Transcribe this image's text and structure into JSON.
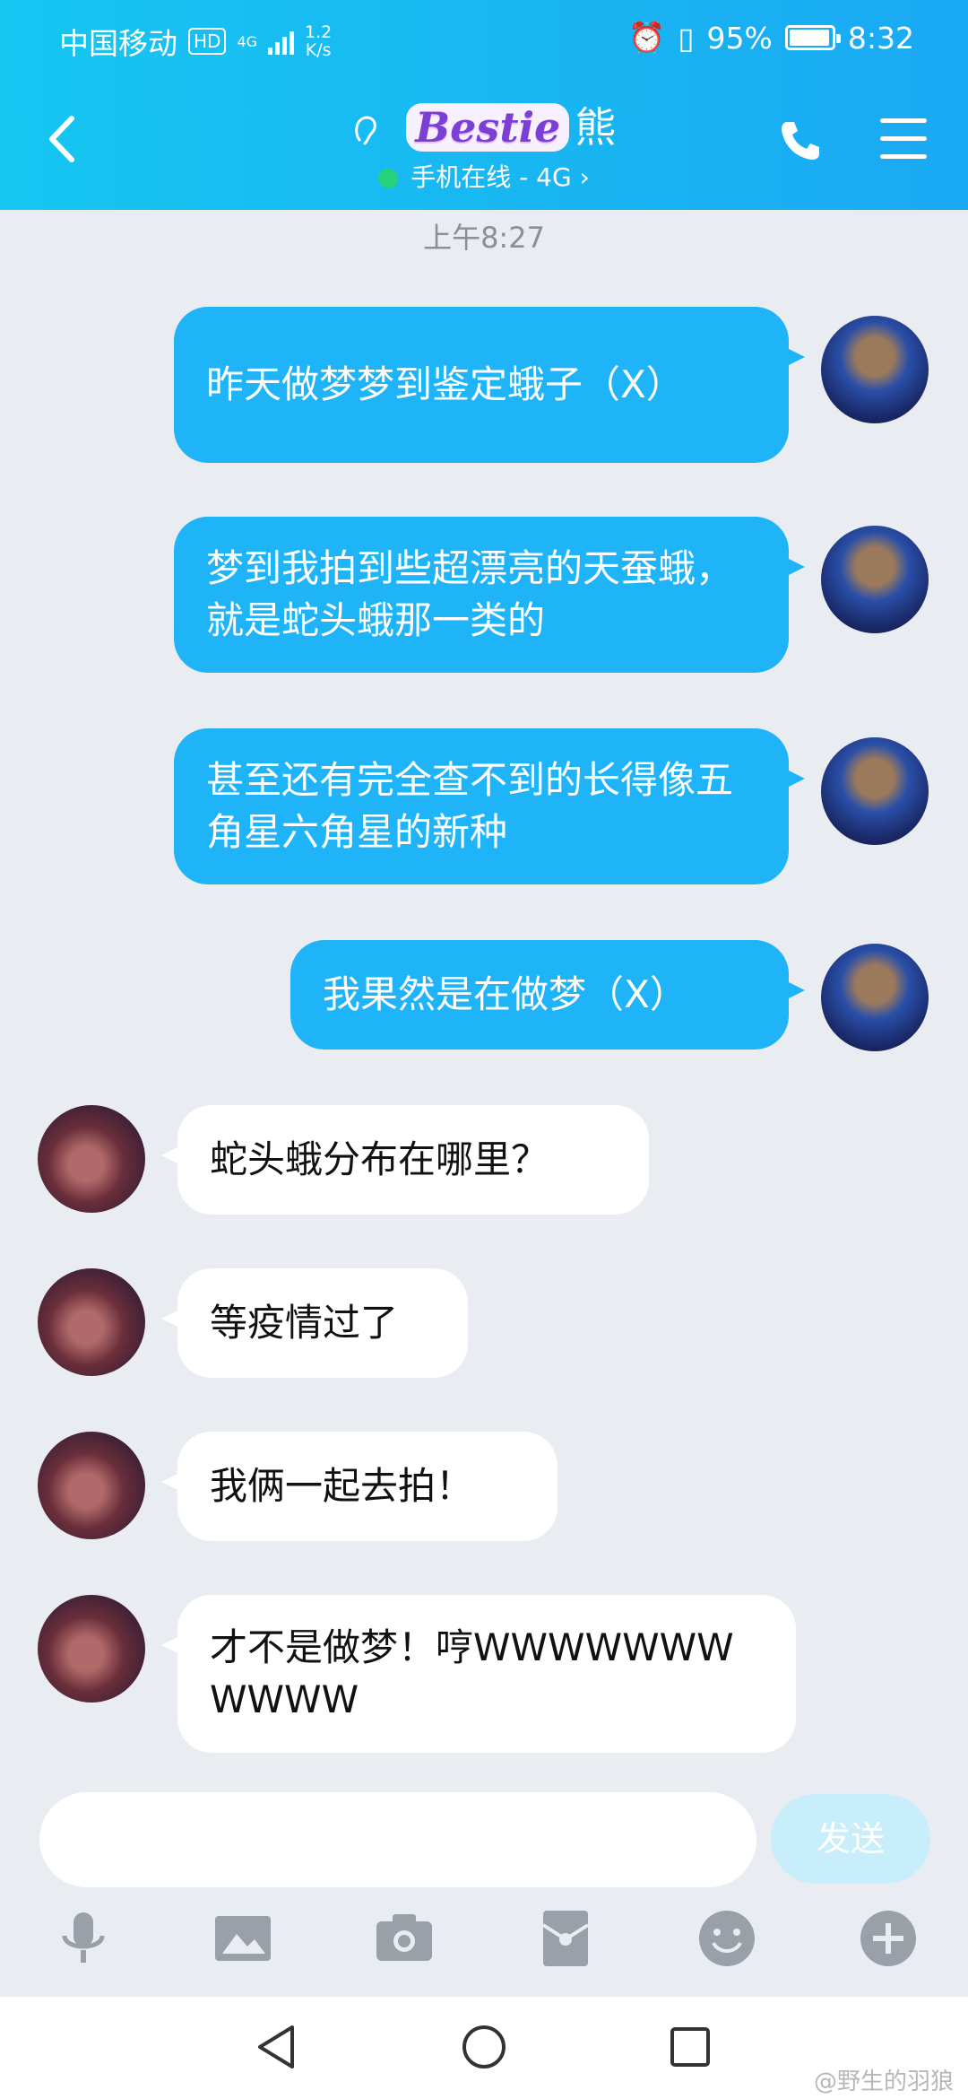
{
  "status": {
    "carrier": "中国移动",
    "hd": "HD",
    "network": "4G",
    "speed_top": "1.2",
    "speed_bottom": "K/s",
    "battery": "95%",
    "time": "8:32"
  },
  "header": {
    "logo_text": "Bestie",
    "name": "熊",
    "online": "手机在线 - 4G",
    "chevron": "›"
  },
  "timestamp": "上午8:27",
  "messages": [
    {
      "side": "mine",
      "text": "昨天做梦梦到鉴定蛾子（X）"
    },
    {
      "side": "mine",
      "text": "梦到我拍到些超漂亮的天蚕蛾，就是蛇头蛾那一类的"
    },
    {
      "side": "mine",
      "text": "甚至还有完全查不到的长得像五角星六角星的新种"
    },
    {
      "side": "mine",
      "text": "我果然是在做梦（X）"
    },
    {
      "side": "theirs",
      "text": "蛇头蛾分布在哪里？"
    },
    {
      "side": "theirs",
      "text": "等疫情过了"
    },
    {
      "side": "theirs",
      "text": "我俩一起去拍！"
    },
    {
      "side": "theirs",
      "text": "才不是做梦！哼WWWWWWWWWWW"
    }
  ],
  "input": {
    "send": "发送"
  },
  "icons": [
    "back-icon",
    "ear-icon",
    "phone-icon",
    "menu-icon",
    "mic-icon",
    "image-icon",
    "camera-icon",
    "red-packet-icon",
    "emoji-icon",
    "plus-icon"
  ],
  "colors": {
    "header": "#1aa9f3",
    "mine_bubble": "#1fb3f7",
    "theirs_bubble": "#ffffff",
    "bg": "#e9ecf1"
  },
  "watermark": "@野生的羽狼"
}
